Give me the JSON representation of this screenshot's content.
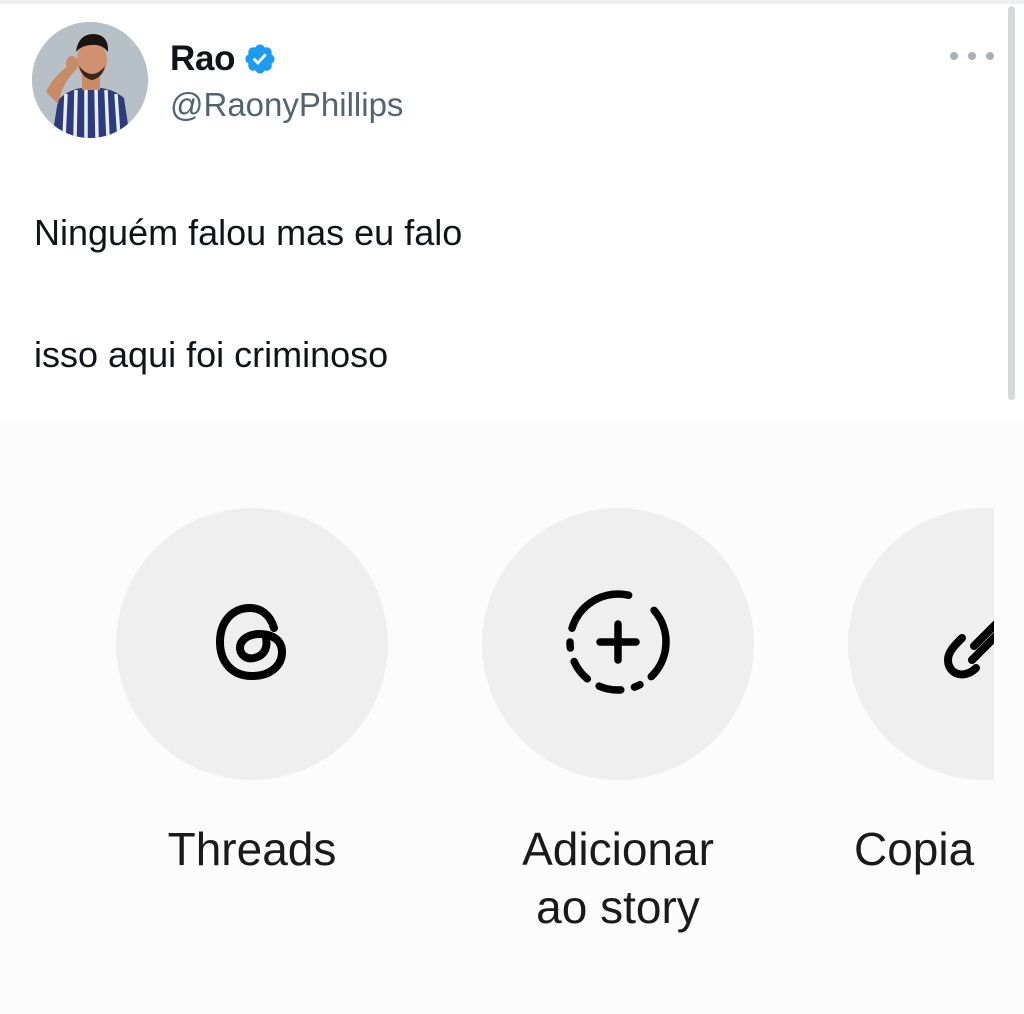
{
  "tweet": {
    "author": {
      "display_name": "Rao",
      "handle": "@RaonyPhillips",
      "verified": true,
      "avatar_icon": "avatar-photo",
      "verified_color": "#1d9bf0"
    },
    "more_icon": "more-horizontal-icon",
    "text_lines": [
      "Ninguém falou mas eu falo",
      "isso aqui foi criminoso"
    ]
  },
  "share_sheet": {
    "items": [
      {
        "icon": "threads-icon",
        "label": "Threads"
      },
      {
        "icon": "add-story-icon",
        "label": "Adicionar\nao story"
      },
      {
        "icon": "link-icon",
        "label": "Copia"
      }
    ]
  }
}
